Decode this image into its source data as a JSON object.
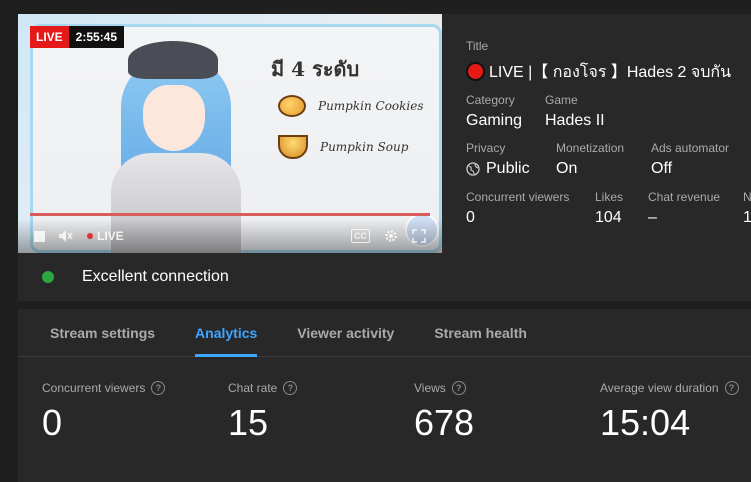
{
  "player": {
    "live_badge": "LIVE",
    "elapsed": "2:55:45",
    "control_live": "LIVE",
    "cc_label": "CC",
    "thumbnail": {
      "heading": "มี 4 ระดับ",
      "item1": "Pumpkin Cookies",
      "item2": "Pumpkin Soup"
    }
  },
  "connection": {
    "status": "Excellent connection",
    "status_color": "#2ba640"
  },
  "details": {
    "title_label": "Title",
    "title_value": "LIVE |【 กองโจร 】Hades 2 จบกัน",
    "category_label": "Category",
    "category_value": "Gaming",
    "game_label": "Game",
    "game_value": "Hades II",
    "privacy_label": "Privacy",
    "privacy_value": "Public",
    "monetization_label": "Monetization",
    "monetization_value": "On",
    "ads_label": "Ads automator",
    "ads_value": "Off",
    "viewers_label": "Concurrent viewers",
    "viewers_value": "0",
    "likes_label": "Likes",
    "likes_value": "104",
    "chat_revenue_label": "Chat revenue",
    "chat_revenue_value": "–",
    "next_label": "N",
    "next_value": "1"
  },
  "tabs": [
    "Stream settings",
    "Analytics",
    "Viewer activity",
    "Stream health"
  ],
  "active_tab": "Analytics",
  "metrics": [
    {
      "label": "Concurrent viewers",
      "value": "0"
    },
    {
      "label": "Chat rate",
      "value": "15"
    },
    {
      "label": "Views",
      "value": "678"
    },
    {
      "label": "Average view duration",
      "value": "15:04"
    }
  ],
  "colors": {
    "accent": "#3ea6ff",
    "live_red": "#e61919",
    "background": "#1f1f1f",
    "card": "#282828"
  }
}
